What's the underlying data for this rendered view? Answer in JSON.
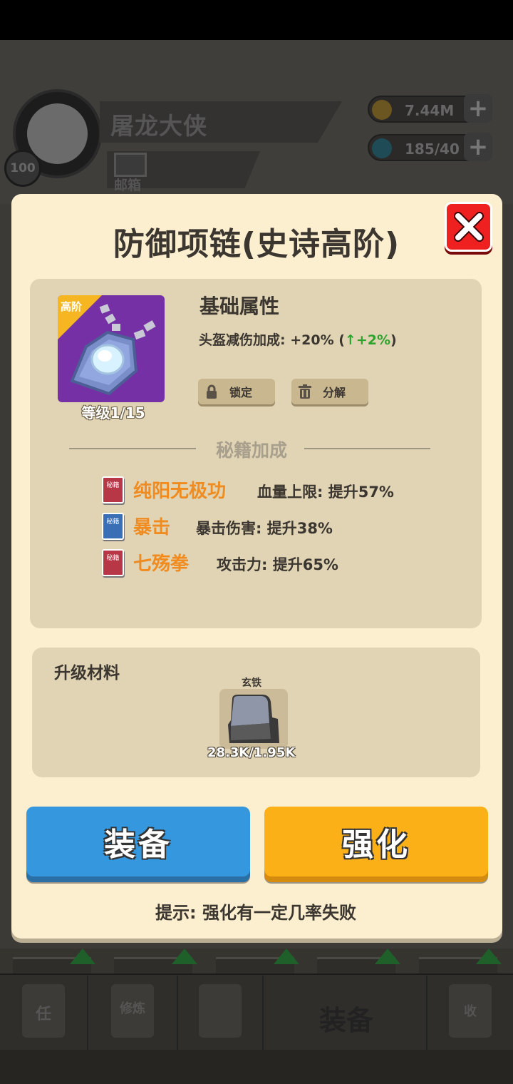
{
  "background": {
    "player_name": "屠龙大侠",
    "player_level": "100",
    "mail_label": "邮箱",
    "gold": "7.44M",
    "gems": "185/40",
    "tab_equip_label": "装备",
    "tab_icons": [
      "任",
      "修炼",
      "收"
    ]
  },
  "modal": {
    "title": "防御项链(史诗高阶)",
    "item": {
      "badge": "高阶",
      "level_text": "等级1/15"
    },
    "base_attr": {
      "title": "基础属性",
      "line_prefix": "头盔减伤加成: +20% (",
      "line_arrow": "↑+2%",
      "line_suffix": ")"
    },
    "buttons": {
      "lock": "锁定",
      "decompose": "分解",
      "equip": "装备",
      "enhance": "强化"
    },
    "secret_bonus": {
      "title": "秘籍加成",
      "book_label": "秘籍",
      "skills": [
        {
          "name": "纯阳无极功",
          "effect": "血量上限: 提升57%",
          "color": "red"
        },
        {
          "name": "暴击",
          "effect": "暴击伤害: 提升38%",
          "color": "blue"
        },
        {
          "name": "七殇拳",
          "effect": "攻击力: 提升65%",
          "color": "red"
        }
      ]
    },
    "materials": {
      "title": "升级材料",
      "item_name": "玄铁",
      "count": "28.3K/1.95K"
    },
    "tip": "提示: 强化有一定几率失败"
  },
  "colors": {
    "equip_button": "#3598df",
    "enhance_button": "#fbb018",
    "close_button": "#ef2020",
    "skill_name": "#ef8b1f",
    "bonus_green": "#2ea32e"
  }
}
